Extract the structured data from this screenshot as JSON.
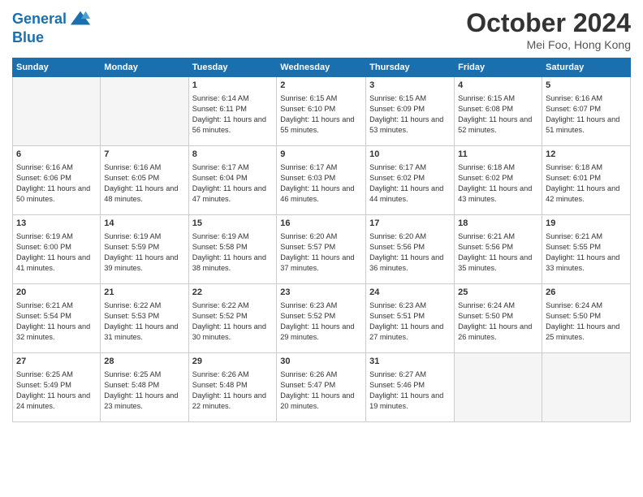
{
  "header": {
    "logo_line1": "General",
    "logo_line2": "Blue",
    "month": "October 2024",
    "location": "Mei Foo, Hong Kong"
  },
  "weekdays": [
    "Sunday",
    "Monday",
    "Tuesday",
    "Wednesday",
    "Thursday",
    "Friday",
    "Saturday"
  ],
  "weeks": [
    [
      {
        "day": "",
        "empty": true
      },
      {
        "day": "",
        "empty": true
      },
      {
        "day": "1",
        "sunrise": "6:14 AM",
        "sunset": "6:11 PM",
        "daylight": "11 hours and 56 minutes"
      },
      {
        "day": "2",
        "sunrise": "6:15 AM",
        "sunset": "6:10 PM",
        "daylight": "11 hours and 55 minutes"
      },
      {
        "day": "3",
        "sunrise": "6:15 AM",
        "sunset": "6:09 PM",
        "daylight": "11 hours and 53 minutes"
      },
      {
        "day": "4",
        "sunrise": "6:15 AM",
        "sunset": "6:08 PM",
        "daylight": "11 hours and 52 minutes"
      },
      {
        "day": "5",
        "sunrise": "6:16 AM",
        "sunset": "6:07 PM",
        "daylight": "11 hours and 51 minutes"
      }
    ],
    [
      {
        "day": "6",
        "sunrise": "6:16 AM",
        "sunset": "6:06 PM",
        "daylight": "11 hours and 50 minutes"
      },
      {
        "day": "7",
        "sunrise": "6:16 AM",
        "sunset": "6:05 PM",
        "daylight": "11 hours and 48 minutes"
      },
      {
        "day": "8",
        "sunrise": "6:17 AM",
        "sunset": "6:04 PM",
        "daylight": "11 hours and 47 minutes"
      },
      {
        "day": "9",
        "sunrise": "6:17 AM",
        "sunset": "6:03 PM",
        "daylight": "11 hours and 46 minutes"
      },
      {
        "day": "10",
        "sunrise": "6:17 AM",
        "sunset": "6:02 PM",
        "daylight": "11 hours and 44 minutes"
      },
      {
        "day": "11",
        "sunrise": "6:18 AM",
        "sunset": "6:02 PM",
        "daylight": "11 hours and 43 minutes"
      },
      {
        "day": "12",
        "sunrise": "6:18 AM",
        "sunset": "6:01 PM",
        "daylight": "11 hours and 42 minutes"
      }
    ],
    [
      {
        "day": "13",
        "sunrise": "6:19 AM",
        "sunset": "6:00 PM",
        "daylight": "11 hours and 41 minutes"
      },
      {
        "day": "14",
        "sunrise": "6:19 AM",
        "sunset": "5:59 PM",
        "daylight": "11 hours and 39 minutes"
      },
      {
        "day": "15",
        "sunrise": "6:19 AM",
        "sunset": "5:58 PM",
        "daylight": "11 hours and 38 minutes"
      },
      {
        "day": "16",
        "sunrise": "6:20 AM",
        "sunset": "5:57 PM",
        "daylight": "11 hours and 37 minutes"
      },
      {
        "day": "17",
        "sunrise": "6:20 AM",
        "sunset": "5:56 PM",
        "daylight": "11 hours and 36 minutes"
      },
      {
        "day": "18",
        "sunrise": "6:21 AM",
        "sunset": "5:56 PM",
        "daylight": "11 hours and 35 minutes"
      },
      {
        "day": "19",
        "sunrise": "6:21 AM",
        "sunset": "5:55 PM",
        "daylight": "11 hours and 33 minutes"
      }
    ],
    [
      {
        "day": "20",
        "sunrise": "6:21 AM",
        "sunset": "5:54 PM",
        "daylight": "11 hours and 32 minutes"
      },
      {
        "day": "21",
        "sunrise": "6:22 AM",
        "sunset": "5:53 PM",
        "daylight": "11 hours and 31 minutes"
      },
      {
        "day": "22",
        "sunrise": "6:22 AM",
        "sunset": "5:52 PM",
        "daylight": "11 hours and 30 minutes"
      },
      {
        "day": "23",
        "sunrise": "6:23 AM",
        "sunset": "5:52 PM",
        "daylight": "11 hours and 29 minutes"
      },
      {
        "day": "24",
        "sunrise": "6:23 AM",
        "sunset": "5:51 PM",
        "daylight": "11 hours and 27 minutes"
      },
      {
        "day": "25",
        "sunrise": "6:24 AM",
        "sunset": "5:50 PM",
        "daylight": "11 hours and 26 minutes"
      },
      {
        "day": "26",
        "sunrise": "6:24 AM",
        "sunset": "5:50 PM",
        "daylight": "11 hours and 25 minutes"
      }
    ],
    [
      {
        "day": "27",
        "sunrise": "6:25 AM",
        "sunset": "5:49 PM",
        "daylight": "11 hours and 24 minutes"
      },
      {
        "day": "28",
        "sunrise": "6:25 AM",
        "sunset": "5:48 PM",
        "daylight": "11 hours and 23 minutes"
      },
      {
        "day": "29",
        "sunrise": "6:26 AM",
        "sunset": "5:48 PM",
        "daylight": "11 hours and 22 minutes"
      },
      {
        "day": "30",
        "sunrise": "6:26 AM",
        "sunset": "5:47 PM",
        "daylight": "11 hours and 20 minutes"
      },
      {
        "day": "31",
        "sunrise": "6:27 AM",
        "sunset": "5:46 PM",
        "daylight": "11 hours and 19 minutes"
      },
      {
        "day": "",
        "empty": true
      },
      {
        "day": "",
        "empty": true
      }
    ]
  ]
}
